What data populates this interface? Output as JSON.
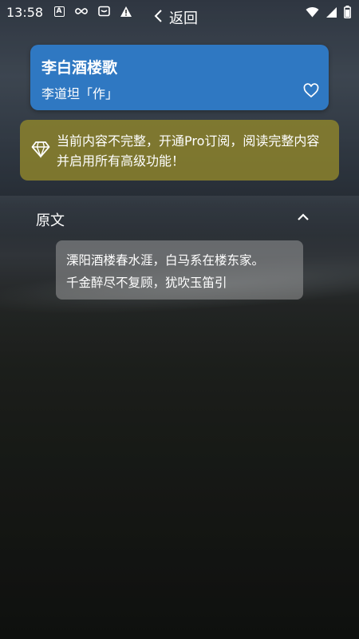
{
  "status_bar": {
    "time": "13:58",
    "left_icons": [
      "a-icon",
      "link-icon",
      "message-icon",
      "warning-icon"
    ],
    "right_icons": [
      "wifi-icon",
      "signal-icon",
      "battery-icon"
    ]
  },
  "nav": {
    "back_label": "返回"
  },
  "poem": {
    "title": "李白酒楼歌",
    "author": "李道坦「作」"
  },
  "pro_banner": {
    "text": "当前内容不完整，开通Pro订阅，阅读完整内容并启用所有高级功能！"
  },
  "section": {
    "title": "原文"
  },
  "content": {
    "lines": [
      "溧阳酒楼春水涯，白马系在楼东家。",
      "千金醉尽不复顾，犹吹玉笛引"
    ]
  },
  "colors": {
    "title_card": "#2f78c2",
    "pro_banner": "#8c822d",
    "text": "#ffffff"
  }
}
